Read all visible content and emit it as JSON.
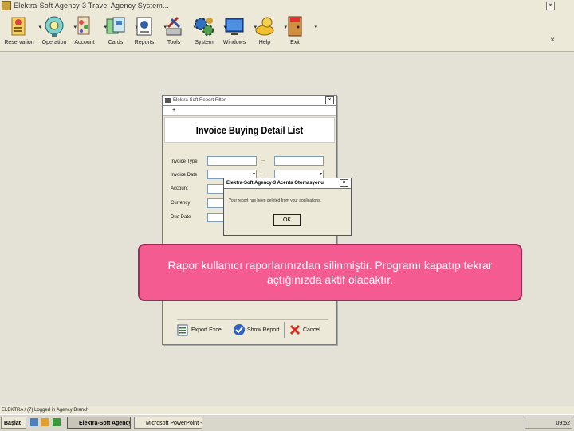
{
  "app": {
    "title": "Elektra-Soft Agency-3 Travel Agency System..."
  },
  "toolbar": {
    "items": [
      {
        "label": "Reservation",
        "icon": "reservation-icon"
      },
      {
        "label": "Operation",
        "icon": "operation-icon"
      },
      {
        "label": "Account",
        "icon": "account-icon"
      },
      {
        "label": "Cards",
        "icon": "cards-icon"
      },
      {
        "label": "Reports",
        "icon": "reports-icon"
      },
      {
        "label": "Tools",
        "icon": "tools-icon"
      },
      {
        "label": "System",
        "icon": "system-icon"
      },
      {
        "label": "Windows",
        "icon": "windows-icon"
      },
      {
        "label": "Help",
        "icon": "help-icon"
      },
      {
        "label": "Exit",
        "icon": "exit-icon"
      }
    ]
  },
  "filter_window": {
    "title": "Elektra-Soft Report Filter",
    "subtitle": "+",
    "heading": "Invoice Buying Detail List",
    "fields": [
      {
        "label": "Invoice Type",
        "sep": "..."
      },
      {
        "label": "Invoice Date",
        "sep": "..."
      },
      {
        "label": "Account"
      },
      {
        "label": "Currency"
      },
      {
        "label": "Due Date"
      }
    ],
    "buttons": {
      "export": "Export Excel",
      "show": "Show Report",
      "cancel": "Cancel"
    }
  },
  "message_box": {
    "title": "Elektra-Soft Agency-3 Acenta Otomasyonu",
    "text": "Your report has been deleted from your applications.",
    "ok": "OK"
  },
  "callout": {
    "text": "Rapor kullanıcı raporlarınızdan silinmiştir. Programı kapatıp tekrar açtığınızda aktif olacaktır."
  },
  "statusbar": {
    "text": "ELEKTRA / (7) Logged in Agency Branch"
  },
  "taskbar": {
    "start": "Başlat",
    "tasks": [
      "Elektra-Soft Agency-...",
      "Microsoft PowerPoint - [..."
    ],
    "clock": "09:52"
  },
  "colors": {
    "callout_fill": "#f35b91",
    "callout_border": "#9c2c58",
    "window_bg": "#ece9d8"
  }
}
